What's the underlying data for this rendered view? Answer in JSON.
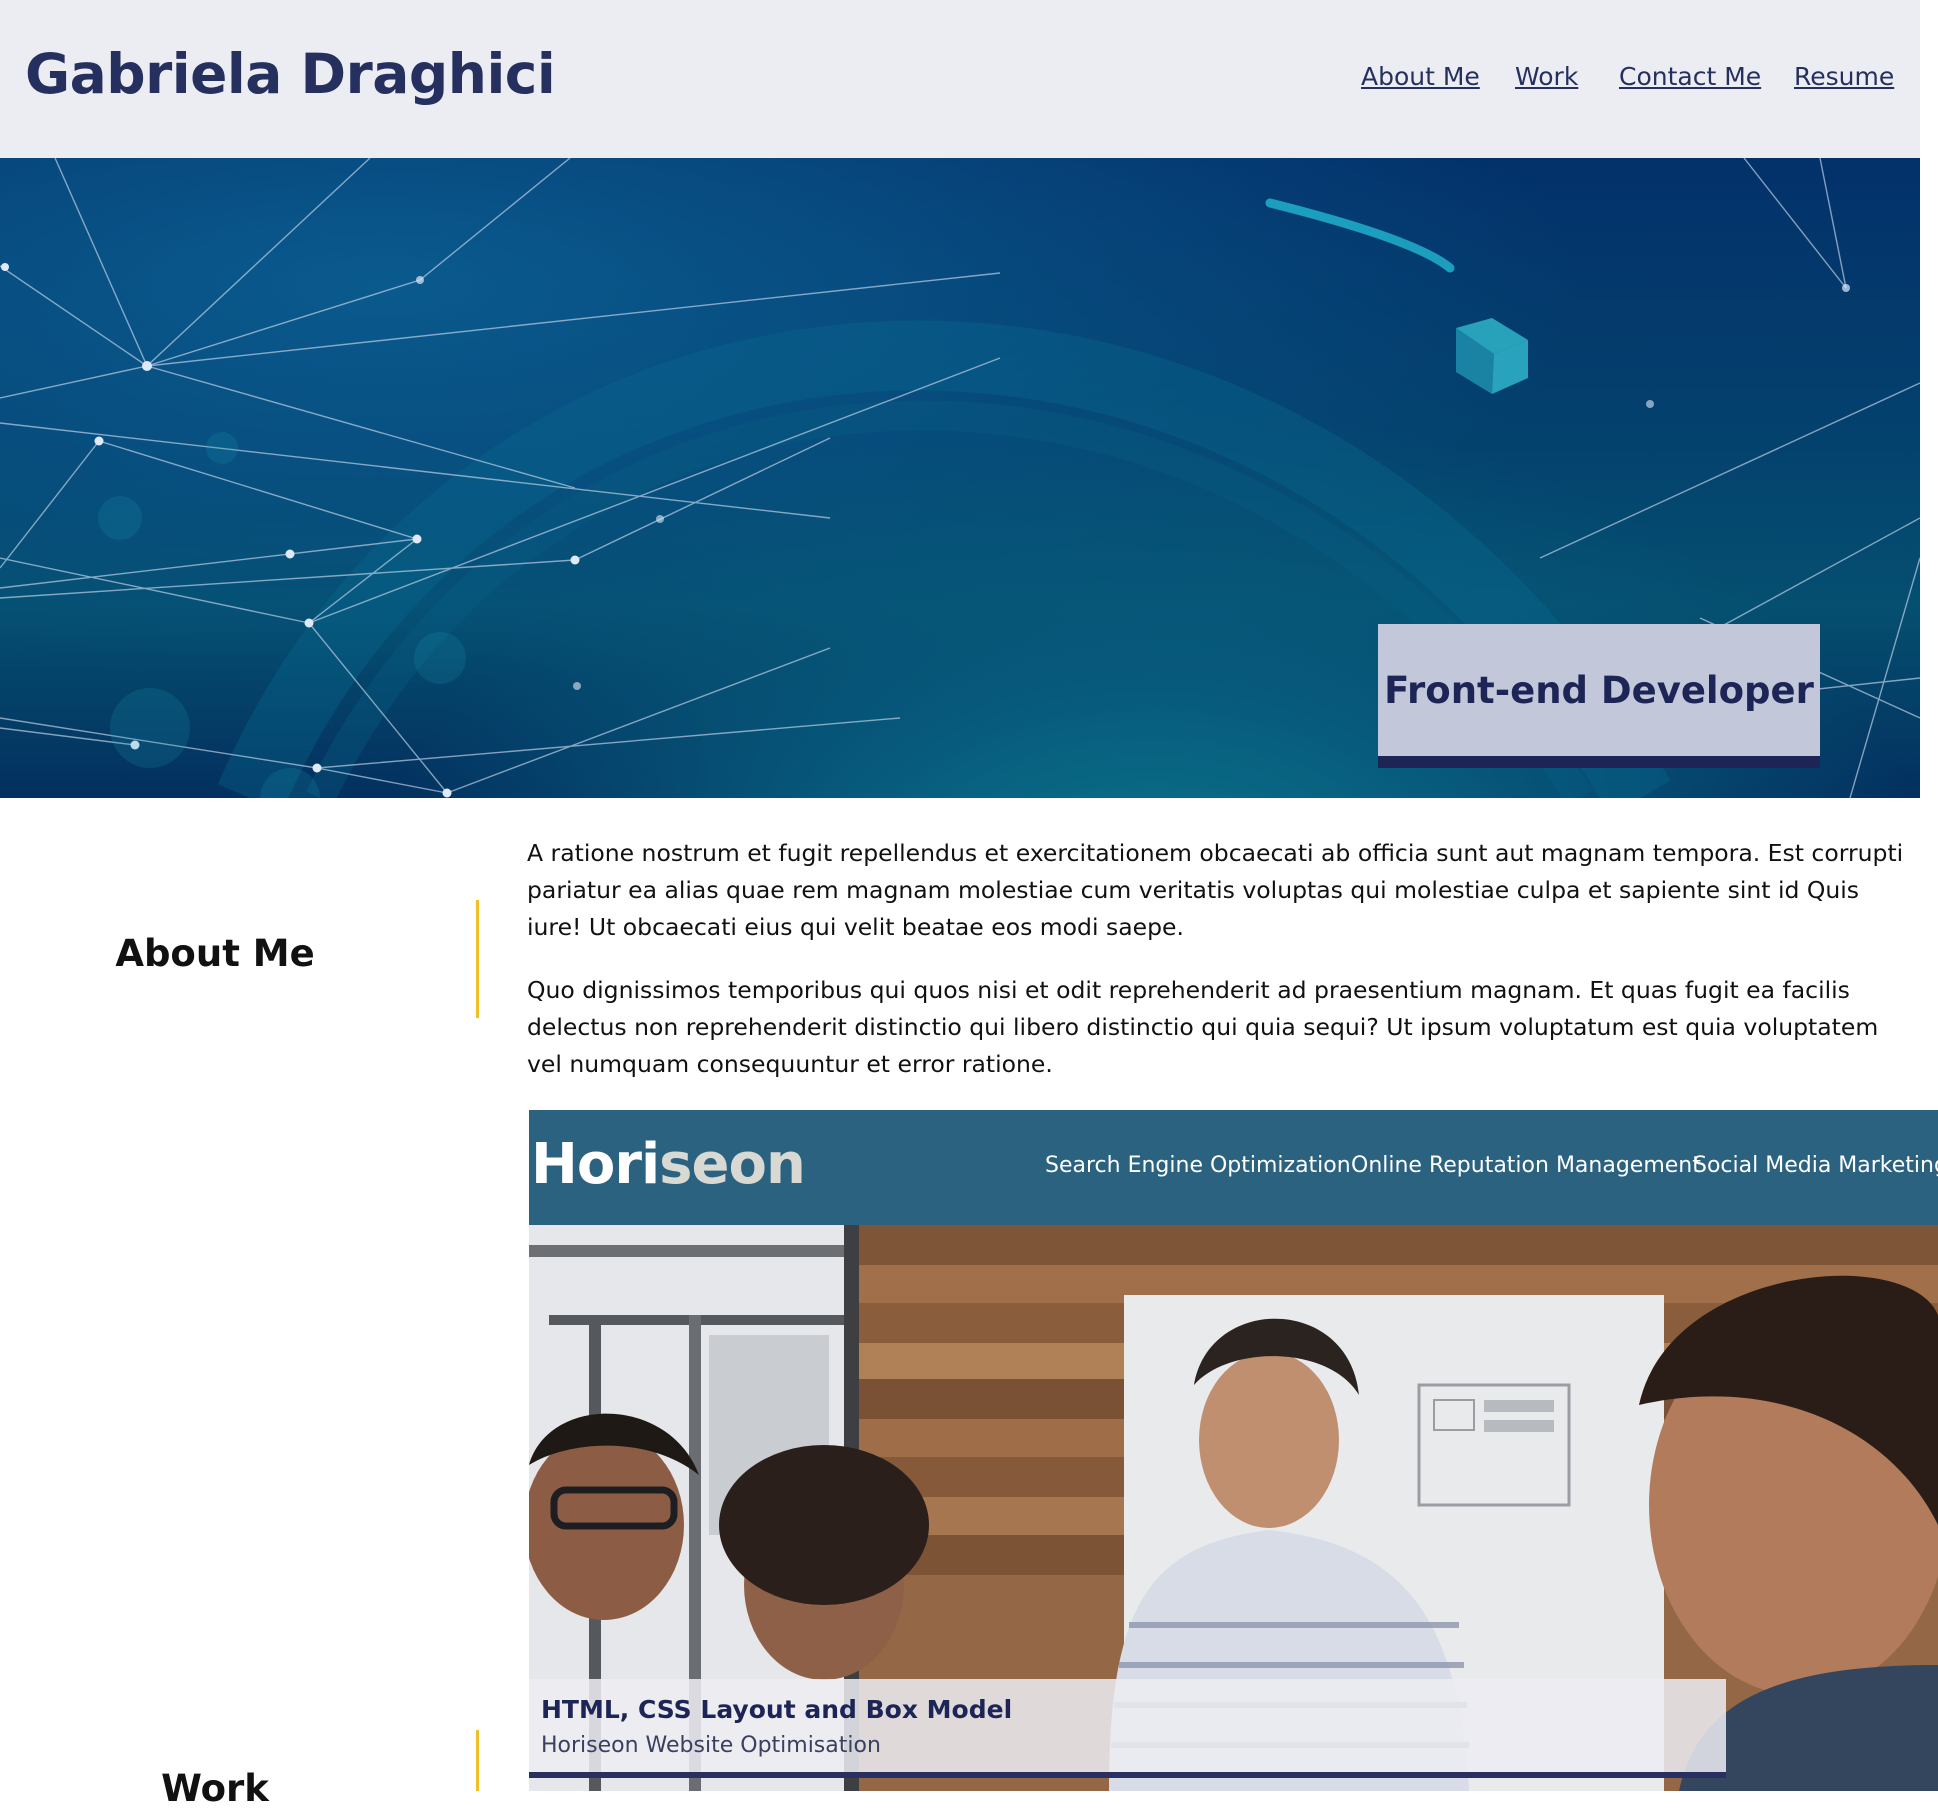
{
  "header": {
    "title": "Gabriela Draghici",
    "nav": [
      {
        "label": "About Me"
      },
      {
        "label": "Work"
      },
      {
        "label": "Contact Me"
      },
      {
        "label": "Resume"
      }
    ]
  },
  "hero": {
    "badge": "Front-end Developer"
  },
  "about": {
    "heading": "About Me",
    "paragraphs": [
      "A ratione nostrum et fugit repellendus et exercitationem obcaecati ab officia sunt aut magnam tempora. Est corrupti pariatur ea alias quae rem magnam molestiae cum veritatis voluptas qui molestiae culpa et sapiente sint id Quis iure! Ut obcaecati eius qui velit beatae eos modi saepe.",
      "Quo dignissimos temporibus qui quos nisi et odit reprehenderit ad praesentium magnam. Et quas fugit ea facilis delectus non reprehenderit distinctio qui libero distinctio qui quia sequi? Ut ipsum voluptatum est quia voluptatem vel numquam consequuntur et error ratione."
    ]
  },
  "work": {
    "heading": "Work",
    "project": {
      "logo_part1": "Hori",
      "logo_part2": "seon",
      "site_nav": [
        "Search Engine Optimization",
        "Online Reputation Management",
        "Social Media Marketing"
      ],
      "title": "HTML, CSS Layout and Box Model",
      "subtitle": "Horiseon Website Optimisation"
    }
  },
  "colors": {
    "header_bg": "#ebedf2",
    "brand_navy": "#26305f",
    "accent_gold": "#f0bf2a",
    "badge_bg": "#c2c8da",
    "card_bar": "#2b6280"
  }
}
